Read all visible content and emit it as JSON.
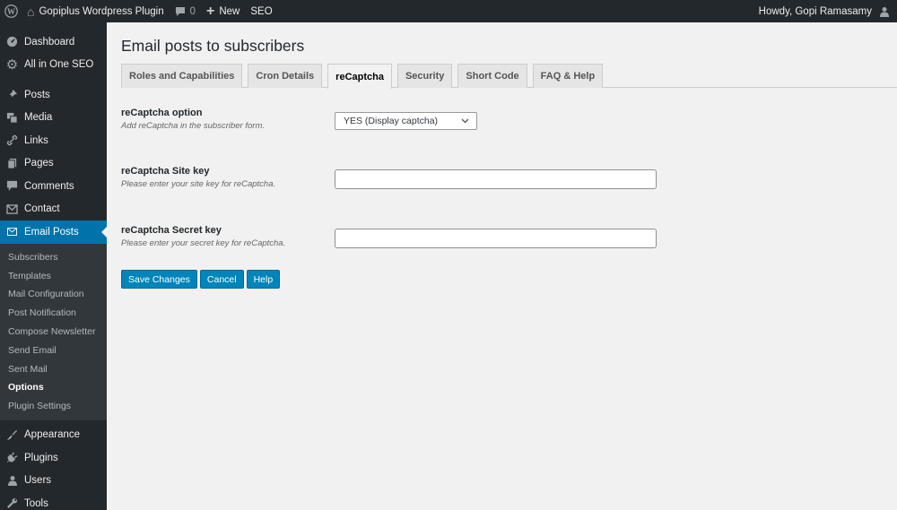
{
  "adminbar": {
    "site_name": "Gopiplus Wordpress Plugin",
    "comments_count": "0",
    "new_label": "New",
    "seo_label": "SEO",
    "greeting": "Howdy, Gopi Ramasamy"
  },
  "sidebar": {
    "items_top": [
      {
        "label": "Dashboard",
        "icon": "dashboard-icon"
      },
      {
        "label": "All in One SEO",
        "icon": "gear-icon"
      }
    ],
    "items_mid": [
      {
        "label": "Posts",
        "icon": "pin-icon"
      },
      {
        "label": "Media",
        "icon": "media-icon"
      },
      {
        "label": "Links",
        "icon": "link-icon"
      },
      {
        "label": "Pages",
        "icon": "pages-icon"
      },
      {
        "label": "Comments",
        "icon": "comment-icon"
      },
      {
        "label": "Contact",
        "icon": "mail-icon"
      }
    ],
    "active_item": {
      "label": "Email Posts",
      "icon": "envelope-icon"
    },
    "submenu": [
      "Subscribers",
      "Templates",
      "Mail Configuration",
      "Post Notification",
      "Compose Newsletter",
      "Send Email",
      "Sent Mail",
      "Options",
      "Plugin Settings"
    ],
    "submenu_current": "Options",
    "items_bottom": [
      {
        "label": "Appearance",
        "icon": "brush-icon"
      },
      {
        "label": "Plugins",
        "icon": "plugin-icon"
      },
      {
        "label": "Users",
        "icon": "user-icon"
      },
      {
        "label": "Tools",
        "icon": "wrench-icon"
      }
    ]
  },
  "page": {
    "title": "Email posts to subscribers",
    "tabs": [
      "Roles and Capabilities",
      "Cron Details",
      "reCaptcha",
      "Security",
      "Short Code",
      "FAQ & Help"
    ],
    "active_tab": "reCaptcha",
    "fields": {
      "option": {
        "label": "reCaptcha option",
        "description": "Add reCaptcha in the subscriber form.",
        "selected": "YES (Display captcha)"
      },
      "site_key": {
        "label": "reCaptcha Site key",
        "description": "Please enter your site key for reCaptcha.",
        "value": ""
      },
      "secret_key": {
        "label": "reCaptcha Secret key",
        "description": "Please enter your secret key for reCaptcha.",
        "value": ""
      }
    },
    "buttons": {
      "save": "Save Changes",
      "cancel": "Cancel",
      "help": "Help"
    }
  },
  "colors": {
    "adminbar_bg": "#23282d",
    "sidebar_bg": "#23282d",
    "submenu_bg": "#32373c",
    "accent": "#0073aa",
    "button": "#0085ba",
    "page_bg": "#f1f1f1"
  }
}
